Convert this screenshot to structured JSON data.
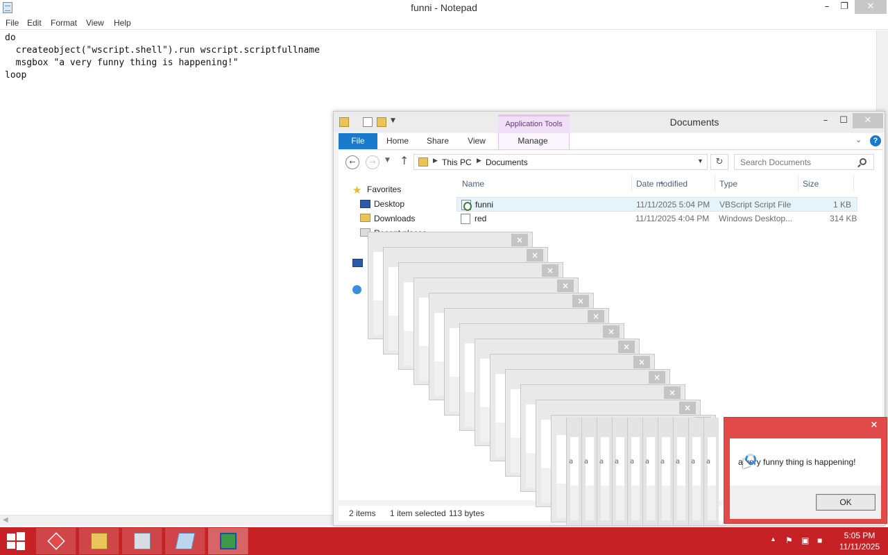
{
  "notepad": {
    "title": "funni - Notepad",
    "menu": [
      "File",
      "Edit",
      "Format",
      "View",
      "Help"
    ],
    "content": "do\n  createobject(\"wscript.shell\").run wscript.scriptfullname\n  msgbox \"a very funny thing is happening!\"\nloop"
  },
  "explorer": {
    "title": "Documents",
    "context_tab": "Application Tools",
    "tabs": {
      "file": "File",
      "home": "Home",
      "share": "Share",
      "view": "View",
      "manage": "Manage"
    },
    "address": {
      "root": "This PC",
      "folder": "Documents"
    },
    "search_placeholder": "Search Documents",
    "nav": {
      "favorites": "Favorites",
      "desktop": "Desktop",
      "downloads": "Downloads",
      "recent": "Recent places"
    },
    "columns": {
      "name": "Name",
      "date": "Date modified",
      "type": "Type",
      "size": "Size"
    },
    "files": [
      {
        "name": "funni",
        "date": "11/11/2025 5:04 PM",
        "type": "VBScript Script File",
        "size": "1 KB",
        "selected": true
      },
      {
        "name": "red",
        "date": "11/11/2025 4:04 PM",
        "type": "Windows Desktop...",
        "size": "314 KB",
        "selected": false
      }
    ],
    "status": {
      "items": "2 items",
      "selected": "1 item selected",
      "bytes": "113 bytes"
    }
  },
  "messagebox": {
    "text": "a very funny thing is happening!",
    "ok": "OK",
    "close_glyph": "×",
    "stack_char": "a"
  },
  "taskbar": {
    "time": "5:05 PM",
    "date": "11/11/2025"
  },
  "colors": {
    "taskbar": "#c62226",
    "accent": "#1979ca",
    "msgbox_frame": "#e24a4a"
  }
}
